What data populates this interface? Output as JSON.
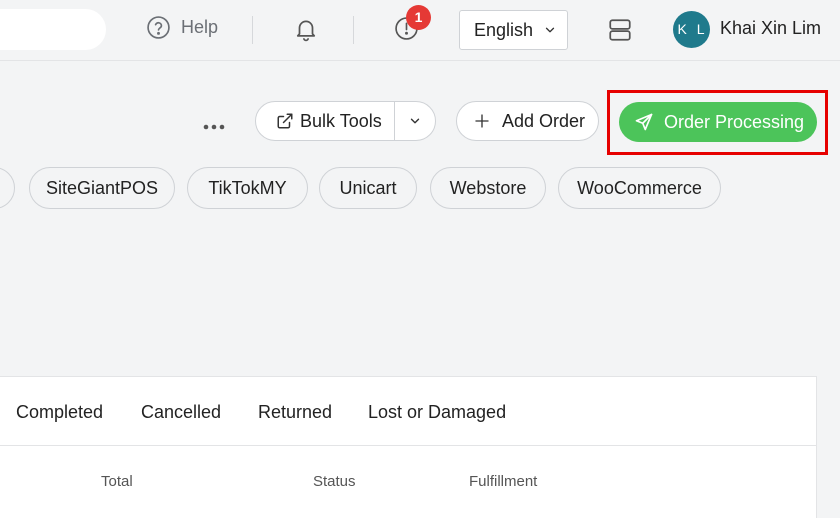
{
  "header": {
    "help_label": "Help",
    "notification_badge": "1",
    "language": "English",
    "user_initials": "K L",
    "user_name": "Khai Xin Lim",
    "avatar_color": "#1f7a8c"
  },
  "toolbar": {
    "more_icon": "more-horizontal-icon",
    "bulk_tools_label": "Bulk Tools",
    "add_order_label": "Add Order",
    "order_processing_label": "Order Processing",
    "order_processing_color": "#4cc45a",
    "highlight_color": "#e60000"
  },
  "channels": [
    "SiteGiantPOS",
    "TikTokMY",
    "Unicart",
    "Webstore",
    "WooCommerce"
  ],
  "tabs": [
    "Completed",
    "Cancelled",
    "Returned",
    "Lost or Damaged"
  ],
  "table": {
    "columns": [
      "Total",
      "Status",
      "Fulfillment"
    ]
  }
}
